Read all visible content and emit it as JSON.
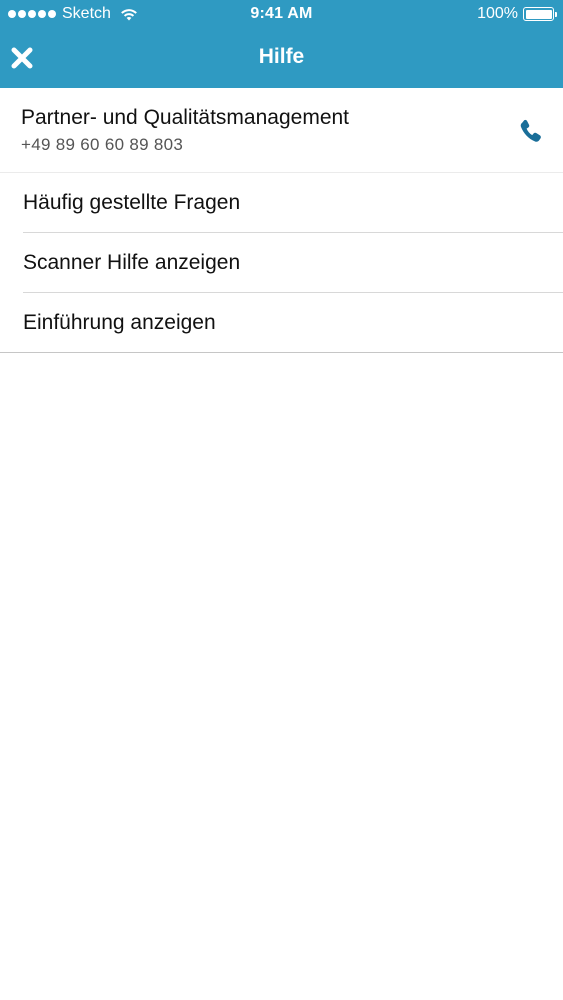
{
  "status_bar": {
    "carrier": "Sketch",
    "time": "9:41 AM",
    "battery_percent": "100%"
  },
  "nav": {
    "title": "Hilfe"
  },
  "contact": {
    "name": "Partner- und Qualitätsmanagement",
    "phone": "+49 89 60 60 89 803"
  },
  "menu_items": [
    {
      "label": "Häufig gestellte Fragen"
    },
    {
      "label": "Scanner Hilfe anzeigen"
    },
    {
      "label": "Einführung anzeigen"
    }
  ],
  "colors": {
    "header": "#2f9ac2",
    "phone_icon": "#1a6e99"
  },
  "icons": [
    "signal-dots-icon",
    "wifi-icon",
    "battery-icon",
    "close-icon",
    "phone-icon"
  ]
}
